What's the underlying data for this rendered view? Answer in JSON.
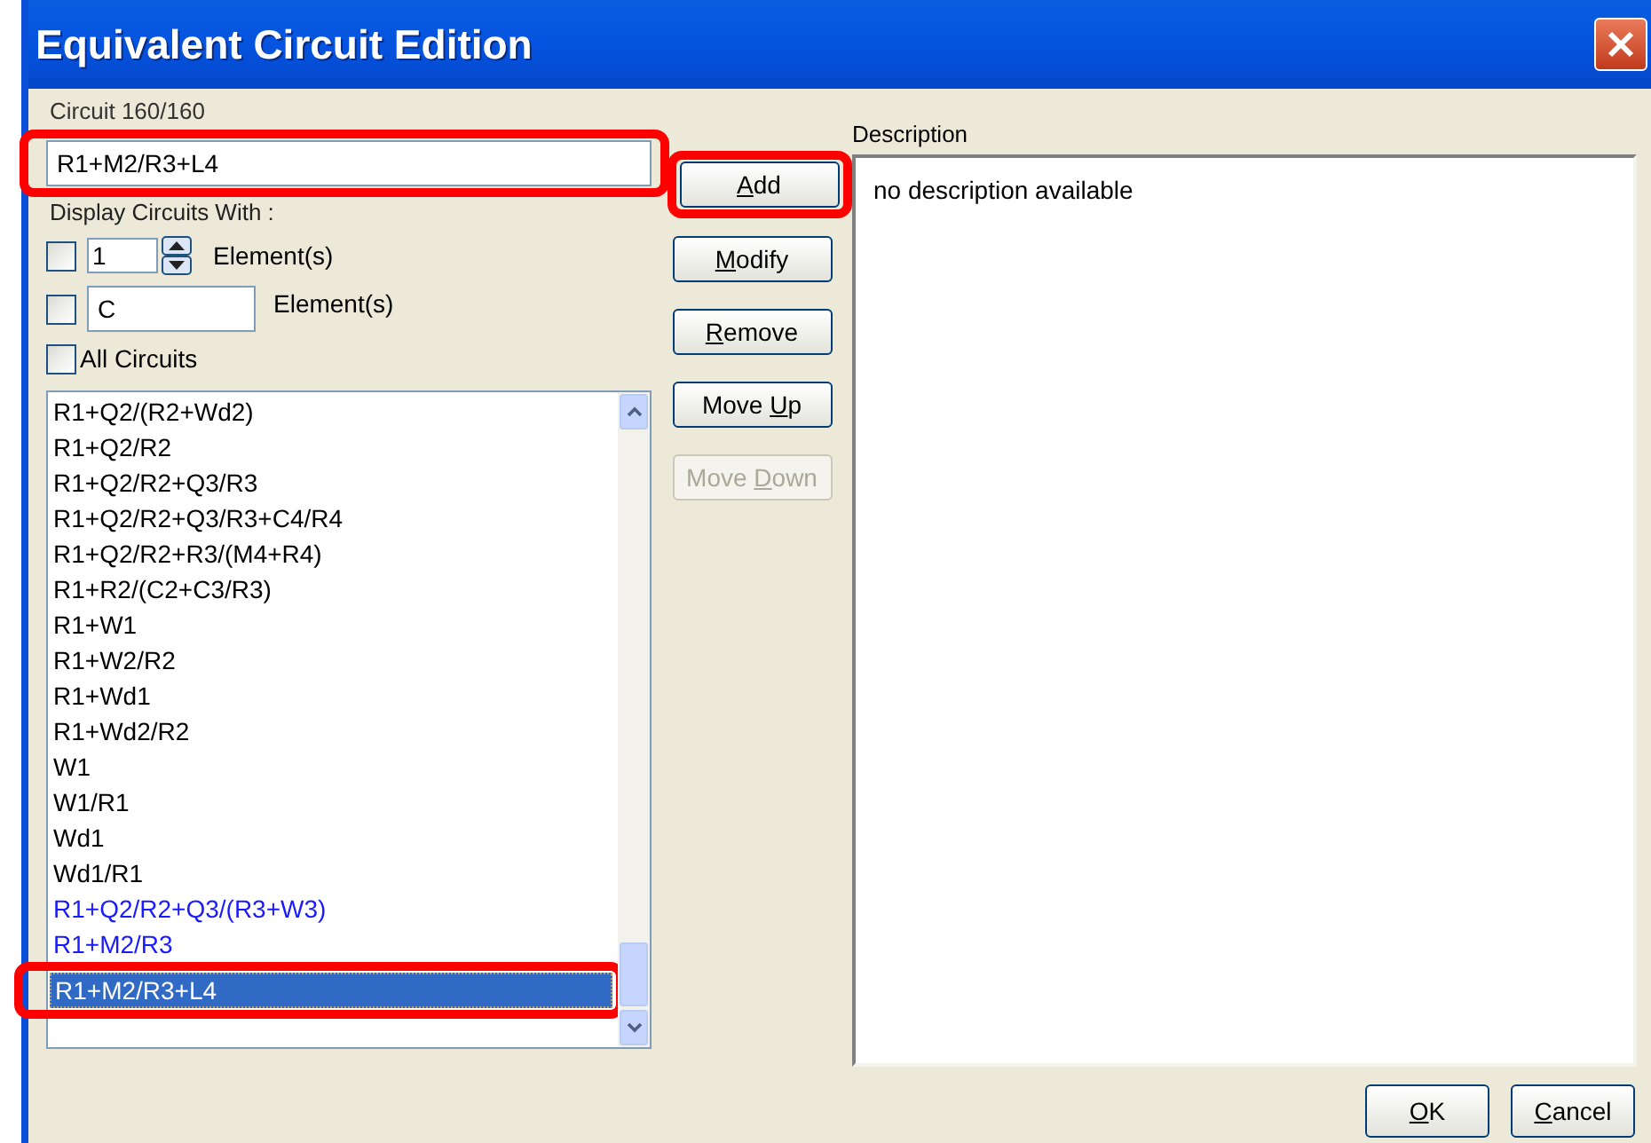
{
  "window": {
    "title": "Equivalent Circuit Edition"
  },
  "circuit": {
    "label": "Circuit 160/160",
    "value": "R1+M2/R3+L4"
  },
  "filter": {
    "label": "Display Circuits With :",
    "count": {
      "checked": false,
      "value": "1",
      "unit": "Element(s)"
    },
    "element": {
      "checked": false,
      "value": "C",
      "unit": "Element(s)"
    },
    "all": {
      "checked": false,
      "label": "All Circuits"
    }
  },
  "buttons": [
    {
      "key": "A",
      "post": "dd",
      "disabled": false
    },
    {
      "key": "M",
      "post": "odify",
      "disabled": false
    },
    {
      "key": "R",
      "post": "emove",
      "disabled": false
    },
    {
      "pre": "Move ",
      "key": "U",
      "post": "p",
      "disabled": false
    },
    {
      "pre": "Move ",
      "key": "D",
      "post": "own",
      "disabled": true
    }
  ],
  "circuits": [
    {
      "text": "R1+Q2/(R2+Wd2)",
      "color": "#000000",
      "selected": false
    },
    {
      "text": "R1+Q2/R2",
      "color": "#000000",
      "selected": false
    },
    {
      "text": "R1+Q2/R2+Q3/R3",
      "color": "#000000",
      "selected": false
    },
    {
      "text": "R1+Q2/R2+Q3/R3+C4/R4",
      "color": "#000000",
      "selected": false
    },
    {
      "text": "R1+Q2/R2+R3/(M4+R4)",
      "color": "#000000",
      "selected": false
    },
    {
      "text": "R1+R2/(C2+C3/R3)",
      "color": "#000000",
      "selected": false
    },
    {
      "text": "R1+W1",
      "color": "#000000",
      "selected": false
    },
    {
      "text": "R1+W2/R2",
      "color": "#000000",
      "selected": false
    },
    {
      "text": "R1+Wd1",
      "color": "#000000",
      "selected": false
    },
    {
      "text": "R1+Wd2/R2",
      "color": "#000000",
      "selected": false
    },
    {
      "text": "W1",
      "color": "#000000",
      "selected": false
    },
    {
      "text": "W1/R1",
      "color": "#000000",
      "selected": false
    },
    {
      "text": "Wd1",
      "color": "#000000",
      "selected": false
    },
    {
      "text": "Wd1/R1",
      "color": "#000000",
      "selected": false
    },
    {
      "text": "R1+Q2/R2+Q3/(R3+W3)",
      "color": "#1a1aff",
      "selected": false
    },
    {
      "text": "R1+M2/R3",
      "color": "#1a1aff",
      "selected": false
    },
    {
      "text": "R1+M2/R3+L4",
      "selected": true
    }
  ],
  "description": {
    "label": "Description",
    "text": "no description available"
  },
  "dialog_buttons": [
    {
      "key": "O",
      "post": "K"
    },
    {
      "key": "C",
      "post": "ancel"
    }
  ]
}
